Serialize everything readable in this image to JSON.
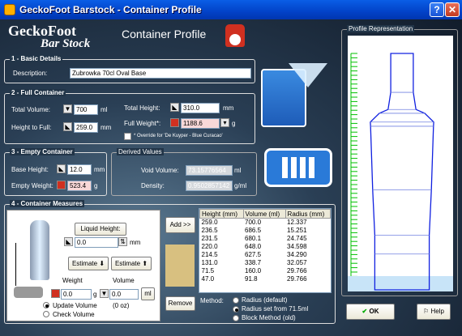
{
  "window": {
    "title": "GeckoFoot Barstock - Container Profile",
    "help": "?",
    "close": "✕"
  },
  "logo": {
    "line1": "GeckoFoot",
    "line2": "Bar Stock"
  },
  "heading": "Container Profile",
  "basic": {
    "legend": "1 - Basic Details",
    "description_label": "Description:",
    "description": "Zubrowka 70cl Oval Base"
  },
  "full": {
    "legend": "2 - Full Container",
    "total_volume_label": "Total Volume:",
    "total_volume": "700",
    "total_volume_unit": "ml",
    "height_to_fill_label": "Height to Full:",
    "height_to_fill": "259.0",
    "height_to_fill_unit": "mm",
    "total_height_label": "Total Height:",
    "total_height": "310.0",
    "total_height_unit": "mm",
    "full_weight_label": "Full Weight*:",
    "full_weight": "1188.6",
    "full_weight_unit": "g",
    "override_note": "* Override for 'De Kuyper - Blue Curacao'"
  },
  "empty": {
    "legend": "3 - Empty Container",
    "base_height_label": "Base Height:",
    "base_height": "12.0",
    "base_height_unit": "mm",
    "empty_weight_label": "Empty Weight:",
    "empty_weight": "523.4",
    "empty_weight_unit": "g"
  },
  "derived": {
    "legend": "Derived Values",
    "void_volume_label": "Void Volume:",
    "void_volume": "73.15776564",
    "void_volume_unit": "ml",
    "density_label": "Density:",
    "density": "0.9502857142",
    "density_unit": "g/ml"
  },
  "measures": {
    "legend": "4 - Container Measures",
    "liquid_height_btn": "Liquid Height:",
    "liquid_height": "0.0",
    "liquid_height_unit": "mm",
    "estimate_down": "Estimate",
    "estimate_up": "Estimate",
    "weight_label": "Weight",
    "volume_label": "Volume",
    "weight": "0.0",
    "weight_unit": "g",
    "volume": "0.0",
    "volume_btn": "ml",
    "update_volume": "Update Volume",
    "check_volume": "Check Volume",
    "oz": "(0 oz)",
    "add_btn": "Add >>",
    "remove_btn": "Remove",
    "table": {
      "headers": [
        "Height (mm)",
        "Volume (ml)",
        "Radius (mm)"
      ],
      "rows": [
        [
          "259.0",
          "700.0",
          "12.337"
        ],
        [
          "236.5",
          "686.5",
          "15.251"
        ],
        [
          "231.5",
          "680.1",
          "24.745"
        ],
        [
          "220.0",
          "648.0",
          "34.598"
        ],
        [
          "214.5",
          "627.5",
          "34.290"
        ],
        [
          "131.0",
          "338.7",
          "32.057"
        ],
        [
          "71.5",
          "160.0",
          "29.766"
        ],
        [
          "47.0",
          "91.8",
          "29.766"
        ]
      ]
    },
    "method_label": "Method:",
    "methods": [
      "Radius (default)",
      "Radius set from 71.5ml",
      "Block Method (old)"
    ]
  },
  "profile": {
    "legend": "Profile Representation"
  },
  "footer": {
    "ok": "OK",
    "help": "Help"
  },
  "colors": {
    "accent": "#0242c8",
    "profile_line": "#1020e0",
    "grid": "#00c000"
  }
}
